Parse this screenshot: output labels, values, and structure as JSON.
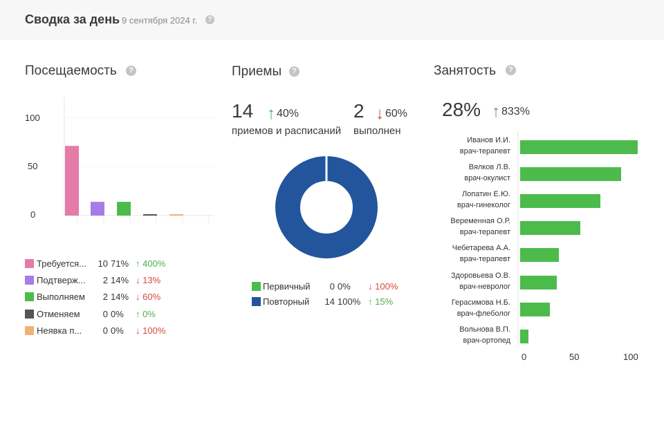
{
  "header": {
    "title": "Сводка за день",
    "date": "9 сентября 2024 г."
  },
  "attendance": {
    "title": "Посещаемость",
    "y_ticks": [
      "100",
      "50",
      "0"
    ],
    "colors": [
      "#e57ba8",
      "#a77ce8",
      "#4cbb4c",
      "#555555",
      "#f0b27a"
    ],
    "legend": [
      {
        "label": "Требуется...",
        "count": "10",
        "pct": "71%",
        "dir": "up",
        "change": "400%"
      },
      {
        "label": "Подтверж...",
        "count": "2",
        "pct": "14%",
        "dir": "down",
        "change": "13%"
      },
      {
        "label": "Выполняем",
        "count": "2",
        "pct": "14%",
        "dir": "down",
        "change": "60%"
      },
      {
        "label": "Отменяем",
        "count": "0",
        "pct": "0%",
        "dir": "up",
        "change": "0%"
      },
      {
        "label": "Неявка п...",
        "count": "0",
        "pct": "0%",
        "dir": "down",
        "change": "100%"
      }
    ]
  },
  "chart_data": [
    {
      "type": "bar",
      "categories": [
        "Требуется...",
        "Подтверж...",
        "Выполняем",
        "Отменяем",
        "Неявка п..."
      ],
      "values": [
        71,
        14,
        14,
        0,
        0
      ],
      "ylim": [
        0,
        100
      ]
    },
    {
      "type": "pie",
      "categories": [
        "Первичный",
        "Повторный"
      ],
      "values": [
        0,
        100
      ]
    },
    {
      "type": "bar",
      "orientation": "horizontal",
      "categories": [
        "Иванов И.И. врач-терапевт",
        "Вялков Л.В. врач-окулист",
        "Лопатин Е.Ю. врач-гинеколог",
        "Веременная О.Р. врач-терапевт",
        "Чебетарева А.А. врач-терапевт",
        "Здоровьева О.В. врач-невролог",
        "Герасимова Н.Б. врач-флеболог",
        "Вольнова В.П. врач-ортопед"
      ],
      "values": [
        100,
        86,
        68,
        51,
        33,
        31,
        25,
        7
      ],
      "xlim": [
        0,
        100
      ],
      "x_ticks": [
        "0",
        "50",
        "100"
      ]
    }
  ],
  "appointments": {
    "title": "Приемы",
    "total": "14",
    "total_change_dir": "up",
    "total_change": "40%",
    "total_label": "приемов и расписаний",
    "done": "2",
    "done_change_dir": "down",
    "done_change": "60%",
    "done_label": "выполнен",
    "colors": [
      "#4cbb4c",
      "#23559c"
    ],
    "legend": [
      {
        "label": "Первичный",
        "count": "0",
        "pct": "0%",
        "dir": "down",
        "change": "100%"
      },
      {
        "label": "Повторный",
        "count": "14",
        "pct": "100%",
        "dir": "up",
        "change": "15%"
      }
    ]
  },
  "occupancy": {
    "title": "Занятость",
    "value": "28%",
    "change_dir": "up",
    "change": "833%",
    "bar_color": "#4cbb4c",
    "doctors": [
      {
        "name": "Иванов И.И.",
        "role": "врач-терапевт"
      },
      {
        "name": "Вялков Л.В.",
        "role": "врач-окулист"
      },
      {
        "name": "Лопатин Е.Ю.",
        "role": "врач-гинеколог"
      },
      {
        "name": "Веременная О.Р.",
        "role": "врач-терапевт"
      },
      {
        "name": "Чебетарева А.А.",
        "role": "врач-терапевт"
      },
      {
        "name": "Здоровьева О.В.",
        "role": "врач-невролог"
      },
      {
        "name": "Герасимова Н.Б.",
        "role": "врач-флеболог"
      },
      {
        "name": "Вольнова В.П.",
        "role": "врач-ортопед"
      }
    ]
  }
}
